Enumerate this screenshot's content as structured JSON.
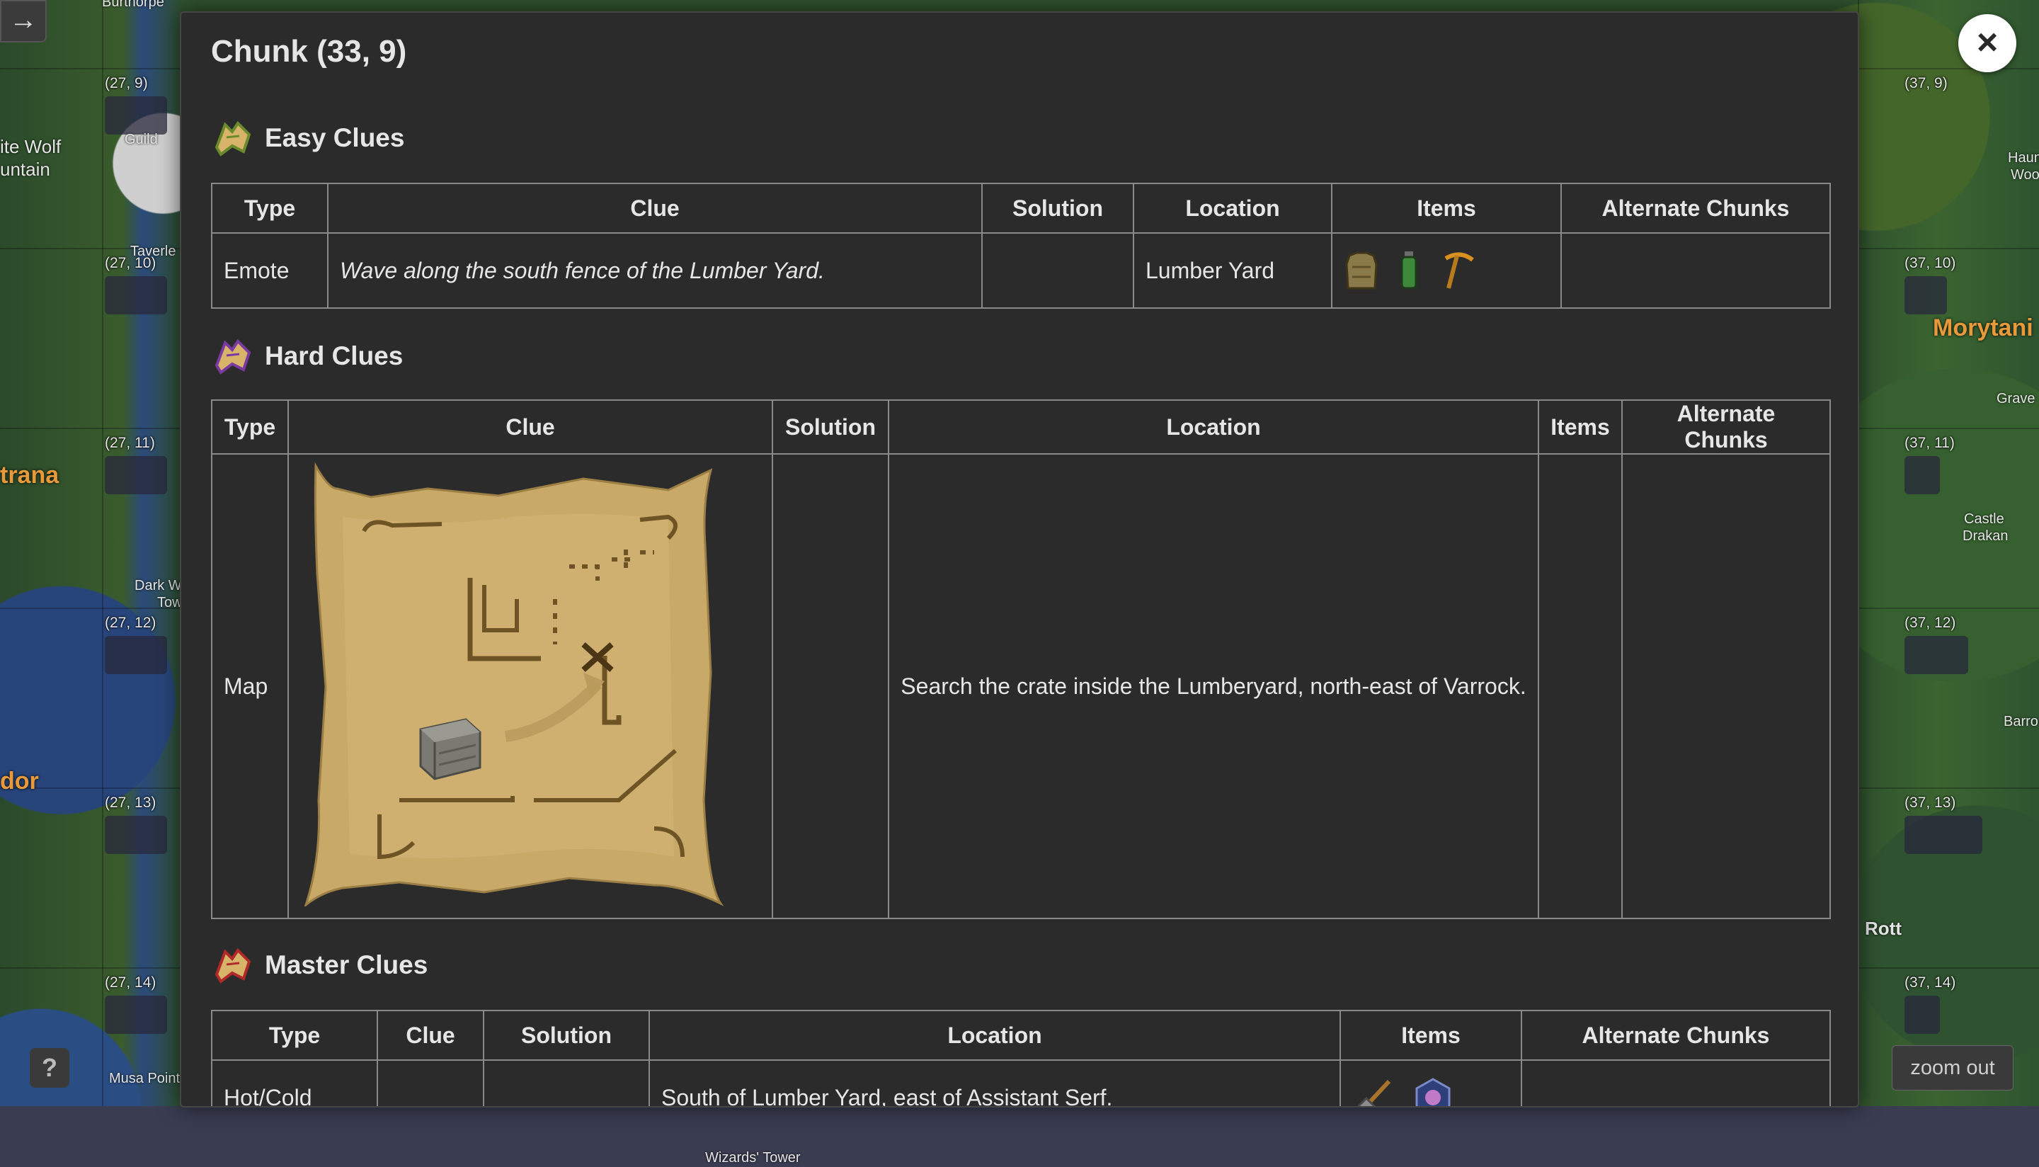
{
  "map": {
    "chunk_labels_left": [
      "(27, 9)",
      "(27, 10)",
      "(27, 11)",
      "(27, 12)",
      "(27, 13)",
      "(27, 14)"
    ],
    "chunk_labels_right": [
      "(37, 9)",
      "(37, 10)",
      "(37, 11)",
      "(37, 12)",
      "(37, 13)",
      "(37, 14)"
    ],
    "place_labels": {
      "burthorpe": "Burthorpe",
      "white_wolf": "ite Wolf",
      "mountain": "untain",
      "guild": "Guild",
      "taverley": "Taverle",
      "trana": "trana",
      "dark_w": "Dark W",
      "tow": "Tow",
      "dor": "dor",
      "musa_point": "Musa Point",
      "morytania": "Morytani",
      "haunted": "Haun",
      "woo": "Woo",
      "grave": "Grave",
      "castle": "Castle",
      "drakan": "Drakan",
      "barro": "Barro",
      "rott": "Rott",
      "wizards_tower": "Wizards' Tower"
    },
    "zoom_out_label": "zoom out",
    "help_label": "?"
  },
  "modal": {
    "title": "Chunk (33, 9)",
    "close_label": "×",
    "easy": {
      "heading": "Easy Clues",
      "columns": [
        "Type",
        "Clue",
        "Solution",
        "Location",
        "Items",
        "Alternate Chunks"
      ],
      "rows": [
        {
          "type": "Emote",
          "clue": "Wave along the south fence of the Lumber Yard.",
          "solution": "",
          "location": "Lumber Yard",
          "items": [
            "leather-body-icon",
            "green-vial-icon",
            "pickaxe-icon"
          ],
          "alternate_chunks": ""
        }
      ]
    },
    "hard": {
      "heading": "Hard Clues",
      "columns": [
        "Type",
        "Clue",
        "Solution",
        "Location",
        "Items",
        "Alternate Chunks"
      ],
      "rows": [
        {
          "type": "Map",
          "clue_image": "treasure-map-icon",
          "solution": "",
          "location": "Search the crate inside the Lumberyard, north-east of Varrock.",
          "items": [],
          "alternate_chunks": ""
        }
      ]
    },
    "master": {
      "heading": "Master Clues",
      "columns": [
        "Type",
        "Clue",
        "Solution",
        "Location",
        "Items",
        "Alternate Chunks"
      ],
      "rows": [
        {
          "type": "Hot/Cold",
          "clue": "",
          "solution": "",
          "location": "South of Lumber Yard, east of Assistant Serf.",
          "items": [
            "spade-icon",
            "strange-device-icon"
          ],
          "alternate_chunks": ""
        }
      ]
    }
  },
  "colors": {
    "modal_bg": "#2b2b2b",
    "border": "#8a8a8a",
    "text": "#e6e6e6",
    "region_label": "#e89a3a"
  }
}
